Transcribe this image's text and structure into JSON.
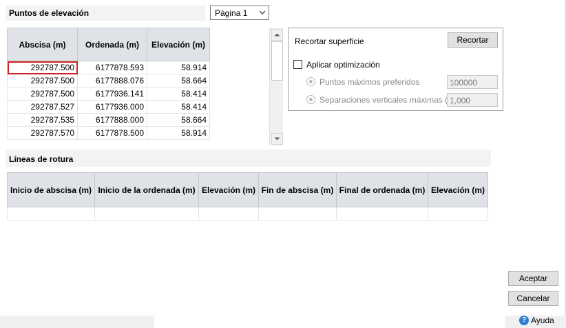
{
  "elevation_points": {
    "title": "Puntos de elevación",
    "page_select": {
      "value": "Página 1"
    },
    "columns": [
      "Abscisa (m)",
      "Ordenada (m)",
      "Elevación (m)"
    ],
    "rows": [
      [
        "292787.500",
        "6177878.593",
        "58.914"
      ],
      [
        "292787.500",
        "6177888.076",
        "58.664"
      ],
      [
        "292787.500",
        "6177936.141",
        "58.414"
      ],
      [
        "292787.527",
        "6177936.000",
        "58.414"
      ],
      [
        "292787.535",
        "6177888.000",
        "58.664"
      ],
      [
        "292787.570",
        "6177878.500",
        "58.914"
      ]
    ]
  },
  "crop_panel": {
    "label": "Recortar superficie",
    "button": "Recortar",
    "optimize_label": "Aplicar optimización",
    "preferred_points_label": "Puntos máximos preferidos",
    "preferred_points_value": "100000",
    "vertical_sep_label": "Separaciones verticales máximas (m)",
    "vertical_sep_value": "1,000"
  },
  "breaklines": {
    "title": "Líneas de rotura",
    "columns": [
      "Inicio de abscisa (m)",
      "Inicio de la ordenada (m)",
      "Elevación (m)",
      "Fin de abscisa (m)",
      "Final de ordenada (m)",
      "Elevación (m)"
    ]
  },
  "buttons": {
    "accept": "Aceptar",
    "cancel": "Cancelar",
    "help": "Ayuda"
  }
}
